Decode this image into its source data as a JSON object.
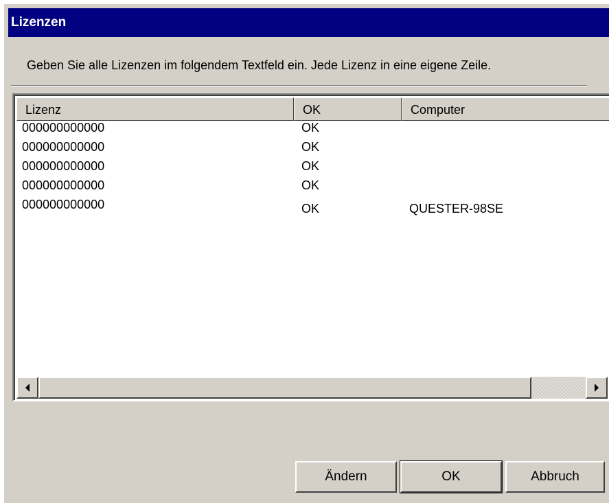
{
  "window": {
    "title": "Lizenzen"
  },
  "instruction": "Geben Sie alle Lizenzen im folgendem Textfeld ein. Jede Lizenz in eine eigene Zeile.",
  "listview": {
    "columns": [
      "Lizenz",
      "OK",
      "Computer"
    ],
    "rows": [
      {
        "lizenz": "000000000000",
        "ok": "OK",
        "computer": ""
      },
      {
        "lizenz": "000000000000",
        "ok": "OK",
        "computer": ""
      },
      {
        "lizenz": "000000000000",
        "ok": "OK",
        "computer": ""
      },
      {
        "lizenz": "000000000000",
        "ok": "OK",
        "computer": ""
      },
      {
        "lizenz": "000000000000",
        "ok": "OK",
        "computer": "QUESTER-98SE"
      }
    ]
  },
  "buttons": {
    "change": "Ändern",
    "ok": "OK",
    "cancel": "Abbruch"
  },
  "icons": {
    "scroll_left": "arrow-left-icon",
    "scroll_right": "arrow-right-icon"
  },
  "colors": {
    "titlebar": "#000080",
    "face": "#d4d0c8",
    "list_bg": "#ffffff"
  }
}
